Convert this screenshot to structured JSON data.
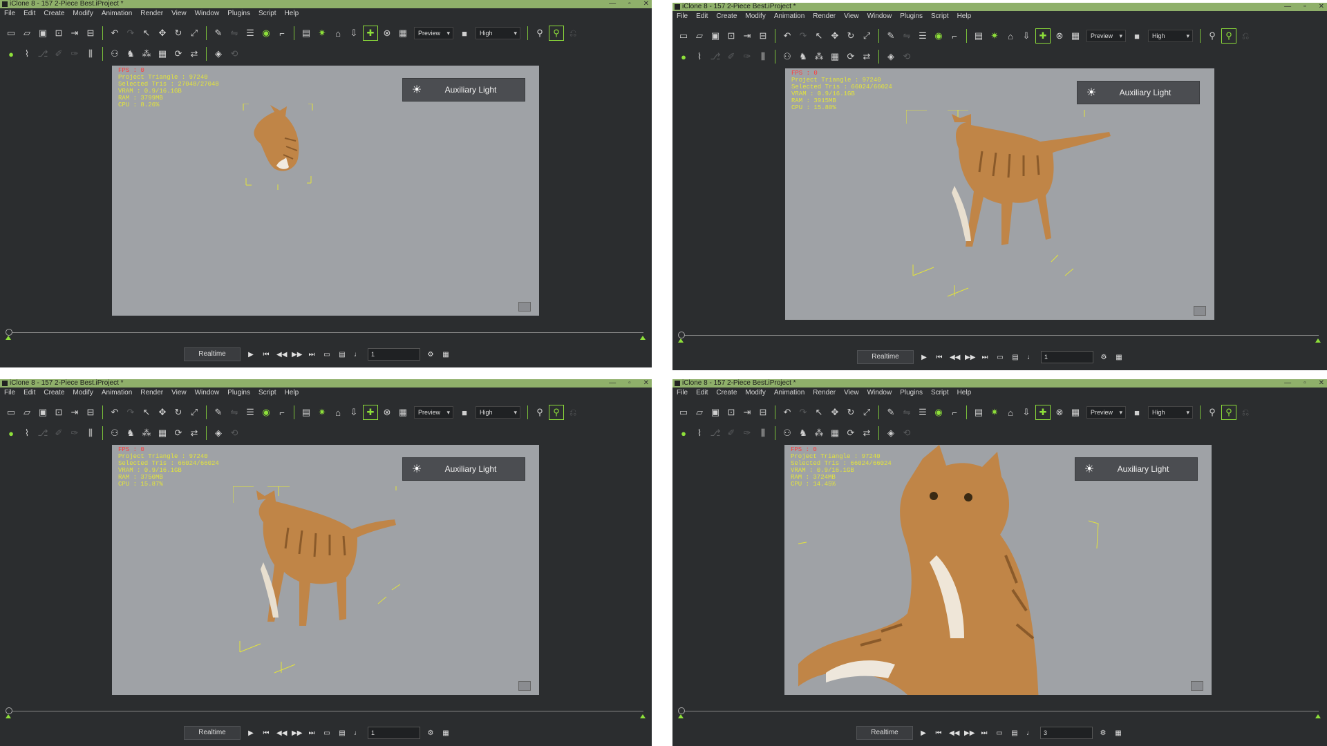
{
  "title": "iClone 8 - 157 2-Piece Best.iProject *",
  "window_controls": {
    "minimize": "—",
    "maximize": "▫",
    "close": "✕"
  },
  "menu": [
    "File",
    "Edit",
    "Create",
    "Modify",
    "Animation",
    "Render",
    "View",
    "Window",
    "Plugins",
    "Script",
    "Help"
  ],
  "toolbar": {
    "preview_label": "Preview",
    "quality_label": "High"
  },
  "aux_light_label": "Auxiliary Light",
  "playback": {
    "realtime_label": "Realtime"
  },
  "stats_labels": {
    "fps": "FPS : 0",
    "project_tris": "Project Triangle : 97240",
    "vram": "VRAM : 0.9/16.1GB"
  },
  "panels": [
    {
      "selected": "Selected Tris : 27048/27048",
      "ram": "RAM : 3799MB",
      "cpu": "CPU : 8.26%",
      "frame": "1"
    },
    {
      "selected": "Selected Tris : 66024/66024",
      "ram": "RAM : 3915MB",
      "cpu": "CPU : 15.80%",
      "frame": "1"
    },
    {
      "selected": "Selected Tris : 66024/66024",
      "ram": "RAM : 3750MB",
      "cpu": "CPU : 15.87%",
      "frame": "1"
    },
    {
      "selected": "Selected Tris : 66024/66024",
      "ram": "RAM : 3724MB",
      "cpu": "CPU : 14.45%",
      "frame": "3"
    }
  ],
  "colors": {
    "accent": "#8ee03a",
    "titlebar": "#8fb06a",
    "stats_text": "#e3e43b",
    "fps_text": "#ff3b3b",
    "viewport_bg": "#9fa2a6"
  },
  "icons": [
    "new-file-icon",
    "open-folder-icon",
    "save-icon",
    "undo-icon",
    "redo-icon",
    "select-icon",
    "move-icon",
    "rotate-icon",
    "scale-icon",
    "light-icon",
    "camera-icon",
    "play-icon",
    "settings-icon"
  ]
}
